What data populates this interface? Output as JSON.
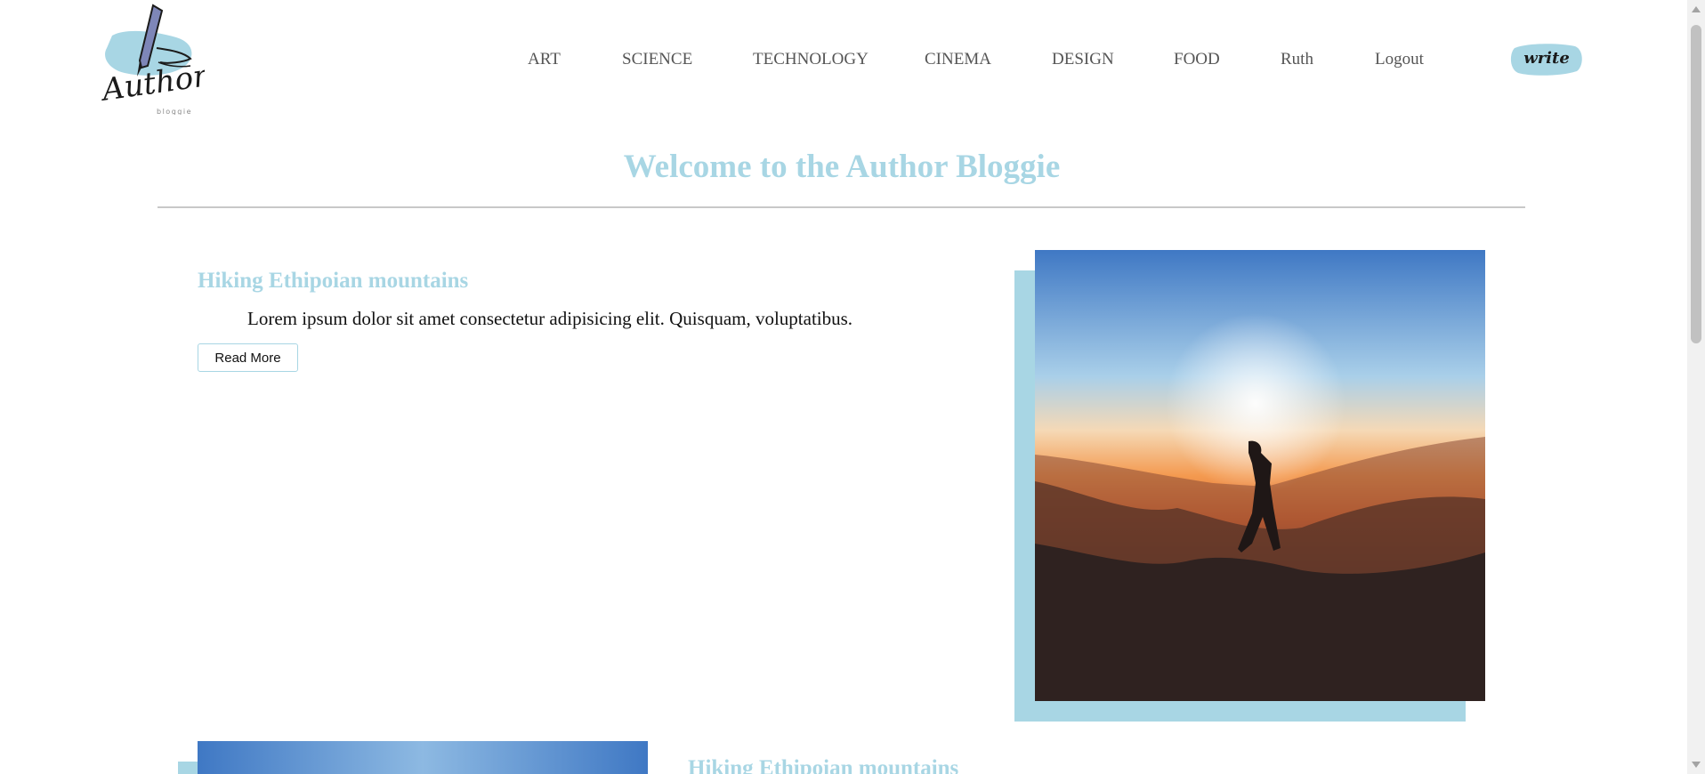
{
  "header": {
    "logo": {
      "text": "Author",
      "subtext": "bloggie"
    },
    "nav": [
      {
        "label": "ART"
      },
      {
        "label": "SCIENCE"
      },
      {
        "label": "TECHNOLOGY"
      },
      {
        "label": "CINEMA"
      },
      {
        "label": "DESIGN"
      },
      {
        "label": "FOOD"
      },
      {
        "label": "Ruth"
      },
      {
        "label": "Logout"
      }
    ],
    "write_label": "write"
  },
  "main": {
    "welcome": "Welcome to the Author Bloggie",
    "posts": [
      {
        "title": "Hiking Ethipoian mountains",
        "excerpt": "Lorem ipsum dolor sit amet consectetur adipisicing elit. Quisquam, voluptatibus.",
        "read_more_label": "Read More"
      },
      {
        "title": "Hiking Ethipoian mountains"
      }
    ]
  },
  "colors": {
    "accent": "#a8d6e4",
    "nav_text": "#555555",
    "divider": "#c8c8c8"
  }
}
